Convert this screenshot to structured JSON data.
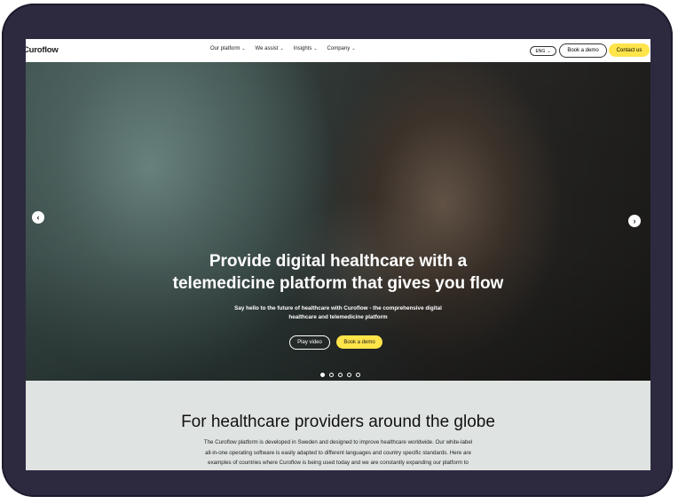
{
  "nav": {
    "logo": "Curoflow",
    "menu": [
      {
        "label": "Our platform"
      },
      {
        "label": "We assist"
      },
      {
        "label": "Insights"
      },
      {
        "label": "Company"
      }
    ],
    "language": "ENG",
    "book_demo": "Book a demo",
    "contact": "Contact us"
  },
  "hero": {
    "title_line1": "Provide digital healthcare with a",
    "title_line2": "telemedicine platform that gives you flow",
    "subtitle_line1": "Say hello to the future of healthcare with Curoflow - the comprehensive digital",
    "subtitle_line2": "healthcare and telemedicine platform",
    "play_video": "Play video",
    "book_demo": "Book a demo",
    "slide_count": 5,
    "active_slide": 1
  },
  "providers": {
    "title": "For healthcare providers around the globe",
    "body_line1": "The Curoflow platform is developed in Sweden and designed to improve healthcare worldwide. Our white-label",
    "body_line2": "all-in-one operating software is easily adapted to different languages and country specific standards. Here are",
    "body_line3": "examples of countries where Curoflow is being used today and we are constantly expanding our platform to"
  },
  "icons": {
    "caret": "chevron-down-icon",
    "prev": "chevron-left-icon",
    "next": "chevron-right-icon"
  },
  "colors": {
    "accent_yellow": "#ffe44a",
    "frame": "#2d2a40",
    "section_bg": "#dfe3e1"
  }
}
